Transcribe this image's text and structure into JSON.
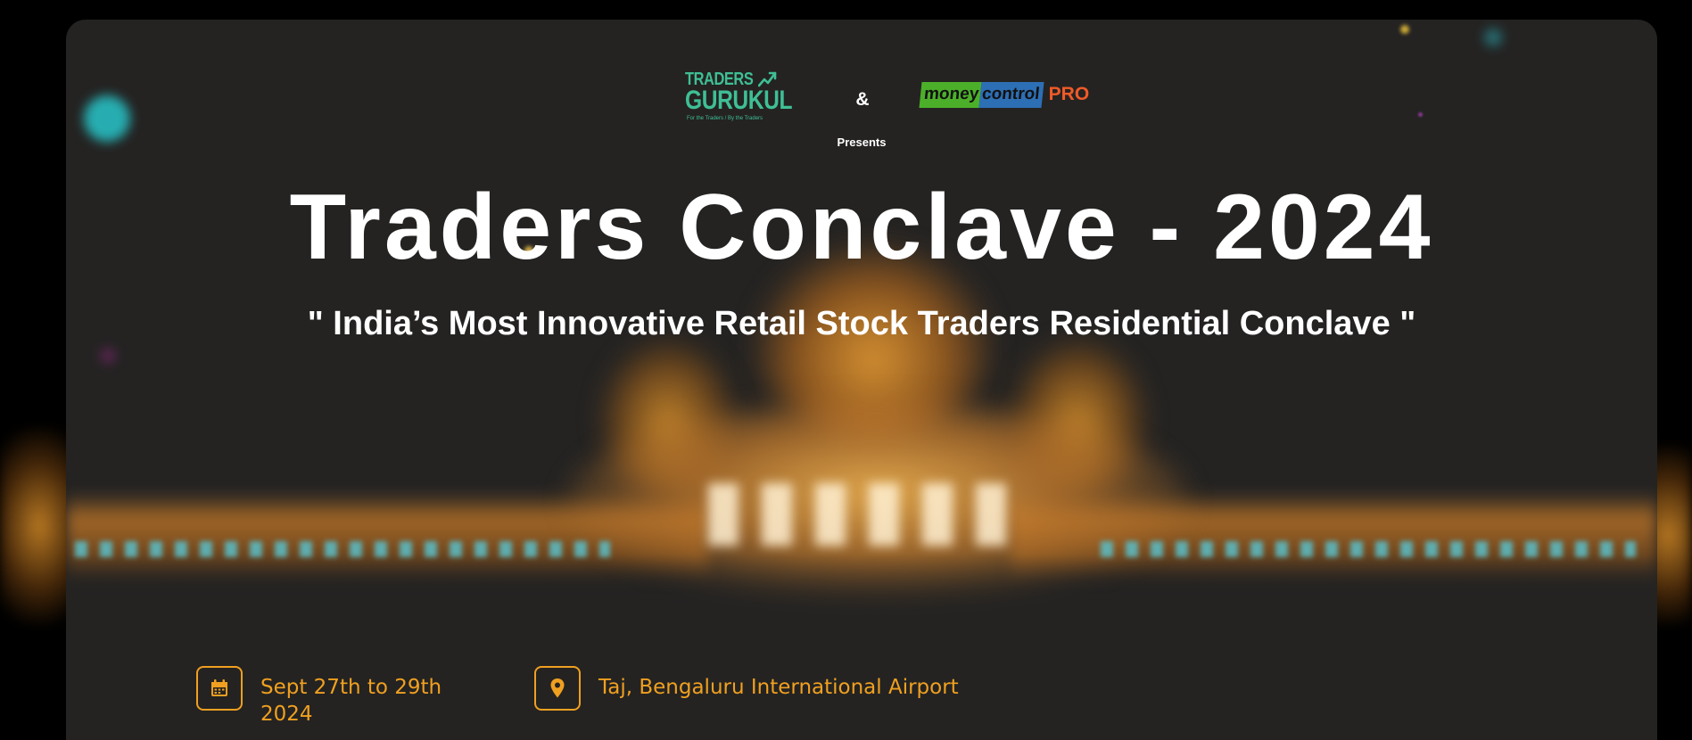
{
  "header": {
    "partner_logo_1": {
      "line1": "TRADERS",
      "line2": "GURUKUL",
      "tagline": "For the Traders / By the Traders",
      "color": "#3fbf95"
    },
    "ampersand": "&",
    "partner_logo_2": {
      "money": "money",
      "control": "control",
      "pro": "PRO",
      "colors": {
        "money_bg": "#4caf2a",
        "control_bg": "#2d6fb5",
        "pro": "#f05a28"
      }
    },
    "presents": "Presents"
  },
  "hero": {
    "title": "Traders Conclave - 2024",
    "subtitle": "\" India’s Most Innovative Retail Stock Traders Residential Conclave \""
  },
  "event_info": {
    "date": {
      "icon": "calendar-icon",
      "text": "Sept 27th to 29th 2024"
    },
    "venue": {
      "icon": "location-pin-icon",
      "text": "Taj, Bengaluru International Airport"
    },
    "accent_color": "#f0a020"
  },
  "theme": {
    "page_bg": "#000000",
    "card_bg": "#242322",
    "text": "#ffffff"
  }
}
